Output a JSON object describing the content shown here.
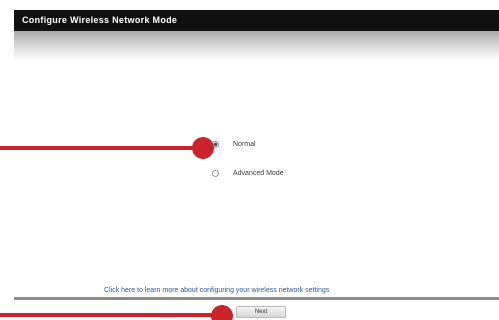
{
  "window": {
    "title": "Configure Wireless Network Mode"
  },
  "options": [
    {
      "label": "Normal",
      "selected": true
    },
    {
      "label": "Advanced Mode",
      "selected": false
    }
  ],
  "hint": {
    "line1": "",
    "line2": ""
  },
  "footer": {
    "link_text": "Click here to learn more about configuring your wireless network settings"
  },
  "buttons": {
    "next_label": "Next"
  },
  "colors": {
    "title_bar": "#111111",
    "callout": "#cc2229",
    "link": "#2b5aa0",
    "rule": "#8d8d8d"
  }
}
